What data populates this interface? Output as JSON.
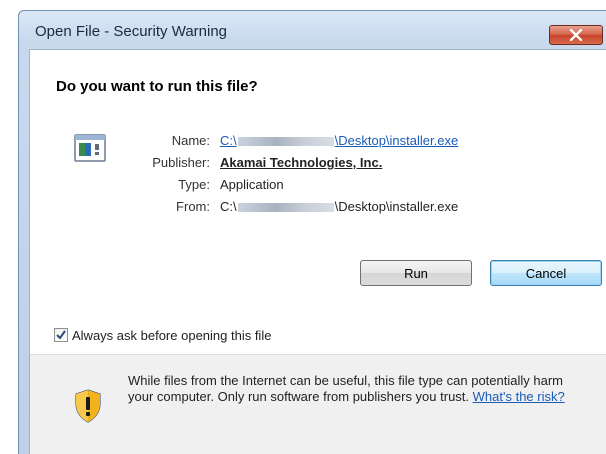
{
  "window": {
    "title": "Open File - Security Warning"
  },
  "dialog": {
    "question": "Do you want to run this file?",
    "fields": {
      "name": {
        "label": "Name:",
        "prefix": "C:\\",
        "suffix": "\\Desktop\\installer.exe"
      },
      "publisher": {
        "label": "Publisher:",
        "value": "Akamai Technologies, Inc."
      },
      "type": {
        "label": "Type:",
        "value": "Application"
      },
      "from": {
        "label": "From:",
        "prefix": "C:\\",
        "suffix": "\\Desktop\\installer.exe"
      }
    },
    "buttons": {
      "run": "Run",
      "cancel": "Cancel"
    },
    "checkbox": {
      "label": "Always ask before opening this file",
      "checked": true
    },
    "warning": {
      "text": "While files from the Internet can be useful, this file type can potentially harm your computer. Only run software from publishers you trust.",
      "link": "What's the risk?"
    }
  },
  "icons": {
    "close": "close-icon",
    "file": "application-file-icon",
    "shield": "security-shield-icon",
    "check": "checkmark-icon"
  },
  "colors": {
    "link": "#1a5cb8",
    "close_button": "#c7422b",
    "shield_yellow": "#f2b21a",
    "shield_blue": "#2f5ea8"
  }
}
